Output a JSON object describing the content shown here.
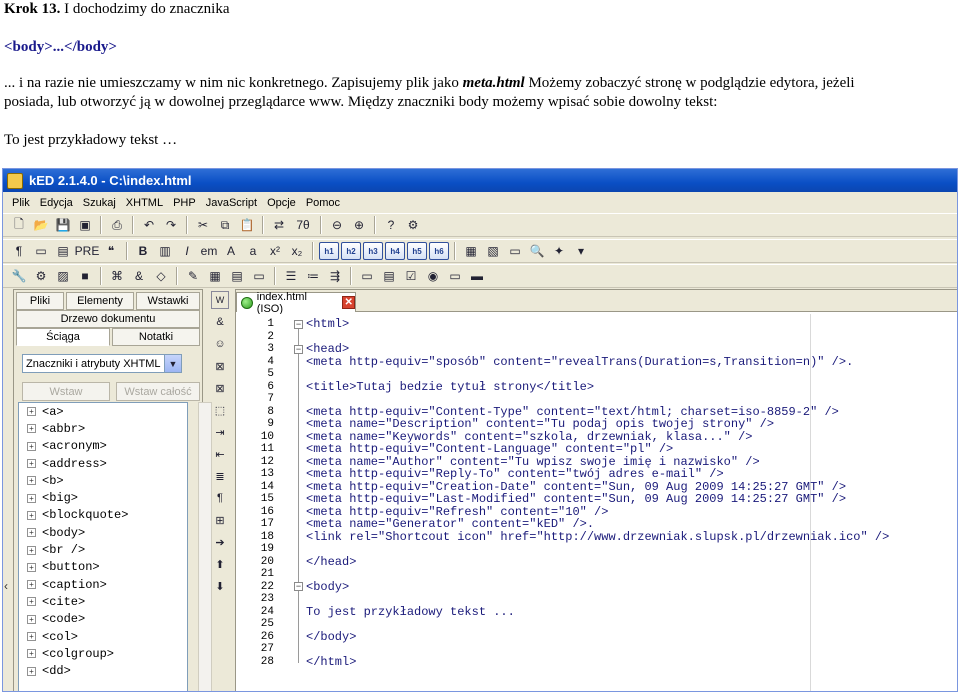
{
  "document": {
    "heading": "Krok 13.",
    "heading_rest": " I dochodzimy do znacznika",
    "tag_title": "<body>...</body>",
    "para_a": "... i na razie nie umieszczamy w nim nic konkretnego. Zapisujemy plik jako ",
    "para_a_bold": "meta.html",
    "para_a_rest": " Możemy zobaczyć stronę w podglądzie edytora, jeżeli",
    "para_b": "posiada, lub otworzyć ją w dowolnej przeglądarce www. Między znaczniki body możemy wpisać sobie dowolny tekst:",
    "example": "To jest przykładowy tekst …"
  },
  "window": {
    "title": "kED 2.1.4.0 - C:\\index.html",
    "menu": [
      "Plik",
      "Edycja",
      "Szukaj",
      "XHTML",
      "PHP",
      "JavaScript",
      "Opcje",
      "Pomoc"
    ],
    "heading_buttons": [
      "h1",
      "h2",
      "h3",
      "h4",
      "h5",
      "h6"
    ]
  },
  "left_panel": {
    "tabs_row1": [
      "Pliki",
      "Elementy",
      "Wstawki"
    ],
    "tab_doc_tree": "Drzewo dokumentu",
    "tabs_row2": [
      "Ściąga",
      "Notatki"
    ],
    "combo_value": "Znaczniki i atrybuty XHTML",
    "btn_insert": "Wstaw",
    "btn_insert_all": "Wstaw całość",
    "tree_items": [
      "<a>",
      "<abbr>",
      "<acronym>",
      "<address>",
      "<b>",
      "<big>",
      "<blockquote>",
      "<body>",
      "<br />",
      "<button>",
      "<caption>",
      "<cite>",
      "<code>",
      "<col>",
      "<colgroup>",
      "<dd>"
    ]
  },
  "editor": {
    "tab_label": "index.html (ISO)",
    "lines": [
      {
        "n": "1",
        "t": "<html>"
      },
      {
        "n": "2",
        "t": ""
      },
      {
        "n": "3",
        "t": "<head>"
      },
      {
        "n": "4",
        "t": "<meta http-equiv=\"sposób\" content=\"revealTrans(Duration=s,Transition=n)\" />."
      },
      {
        "n": "5",
        "t": ""
      },
      {
        "n": "6",
        "t": "<title>Tutaj bedzie tytuł strony</title>"
      },
      {
        "n": "7",
        "t": ""
      },
      {
        "n": "8",
        "t": "<meta http-equiv=\"Content-Type\" content=\"text/html; charset=iso-8859-2\" />"
      },
      {
        "n": "9",
        "t": "<meta name=\"Description\" content=\"Tu podaj opis twojej strony\" />"
      },
      {
        "n": "10",
        "t": "<meta name=\"Keywords\" content=\"szkola, drzewniak, klasa...\" />"
      },
      {
        "n": "11",
        "t": "<meta http-equiv=\"Content-Language\" content=\"pl\" />"
      },
      {
        "n": "12",
        "t": "<meta name=\"Author\" content=\"Tu wpisz swoje imię i nazwisko\" />"
      },
      {
        "n": "13",
        "t": "<meta http-equiv=\"Reply-To\" content=\"twój adres e-mail\" />"
      },
      {
        "n": "14",
        "t": "<meta http-equiv=\"Creation-Date\" content=\"Sun, 09 Aug 2009 14:25:27 GMT\" />"
      },
      {
        "n": "15",
        "t": "<meta http-equiv=\"Last-Modified\" content=\"Sun, 09 Aug 2009 14:25:27 GMT\" />"
      },
      {
        "n": "16",
        "t": "<meta http-equiv=\"Refresh\" content=\"10\" />"
      },
      {
        "n": "17",
        "t": "<meta name=\"Generator\" content=\"kED\" />."
      },
      {
        "n": "18",
        "t": "<link rel=\"Shortcout icon\" href=\"http://www.drzewniak.slupsk.pl/drzewniak.ico\" />"
      },
      {
        "n": "19",
        "t": ""
      },
      {
        "n": "20",
        "t": "</head>"
      },
      {
        "n": "21",
        "t": ""
      },
      {
        "n": "22",
        "t": "<body>"
      },
      {
        "n": "23",
        "t": ""
      },
      {
        "n": "24",
        "t": "To jest przykładowy tekst ..."
      },
      {
        "n": "25",
        "t": ""
      },
      {
        "n": "26",
        "t": "</body>"
      },
      {
        "n": "27",
        "t": ""
      },
      {
        "n": "28",
        "t": "</html>"
      }
    ]
  }
}
